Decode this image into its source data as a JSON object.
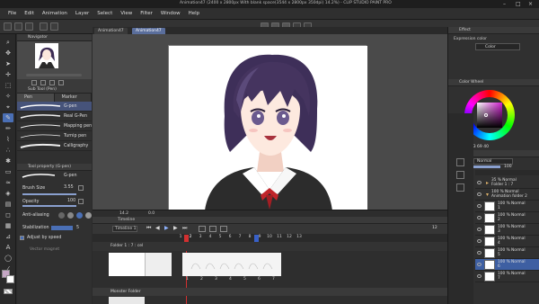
{
  "window": {
    "title": "Animation47 (2400 x 2800px With blank space(3544 x 2800px 350dpi) 14.2%) - CLIP STUDIO PAINT PRO"
  },
  "menu": [
    "File",
    "Edit",
    "Animation",
    "Layer",
    "Select",
    "View",
    "Filter",
    "Window",
    "Help"
  ],
  "canvas_tabs": [
    {
      "label": "Animation47",
      "active": false
    },
    {
      "label": "Animation47",
      "active": true
    }
  ],
  "navigator": {
    "title": "Navigator"
  },
  "subtool": {
    "title": "Sub Tool (Pen)",
    "tabs": [
      "Pen",
      "Marker"
    ],
    "brushes": [
      {
        "name": "G-pen",
        "selected": true
      },
      {
        "name": "Real G-Pen",
        "selected": false
      },
      {
        "name": "Mapping pen",
        "selected": false
      },
      {
        "name": "Turnip pen",
        "selected": false
      },
      {
        "name": "Calligraphy",
        "selected": false
      }
    ]
  },
  "toolprop": {
    "title": "Tool property (G-pen)",
    "preset": "G-pen",
    "brush_size_label": "Brush Size",
    "brush_size_value": "3.55",
    "opacity_label": "Opacity",
    "opacity_value": "100",
    "antialias_label": "Anti-aliasing",
    "stabilization_label": "Stabilization",
    "stabilization_value": "5",
    "adjust_speed_label": "Adjust by speed",
    "vector_magnet_label": "Vector magnet"
  },
  "status": {
    "zoom": "14.2",
    "rotation": "0.0"
  },
  "timeline": {
    "title": "Timeline",
    "name": "Timeline 1",
    "frame_numbers": [
      "1",
      "2",
      "3",
      "4",
      "5",
      "6",
      "7",
      "8",
      "9",
      "10",
      "11",
      "12",
      "13"
    ],
    "cel_numbers": [
      "1",
      "2",
      "3",
      "4",
      "5",
      "6",
      "7"
    ],
    "current_frame": "2",
    "tracks": [
      {
        "label": "Folder 1 : 7 : cel"
      },
      {
        "label": "Monster Folder"
      }
    ],
    "fps": "12"
  },
  "right": {
    "effect_title": "Effect",
    "expression_label": "Expression color",
    "expression_value": "Color",
    "colorwheel_title": "Color Wheel",
    "color_h": "303",
    "color_s": "69",
    "color_v": "40",
    "layer_title": "Layer",
    "blend_mode": "Normal",
    "opacity": "100",
    "layers": [
      {
        "line1": "35 % Normal",
        "line2": "Folder 1 : 7",
        "selected": false,
        "folder": true
      },
      {
        "line1": "100 % Normal",
        "line2": "Animation folder 2",
        "selected": false,
        "folder": true
      },
      {
        "line1": "100 % Normal",
        "line2": "1",
        "selected": false,
        "folder": false
      },
      {
        "line1": "100 % Normal",
        "line2": "2",
        "selected": false,
        "folder": false
      },
      {
        "line1": "100 % Normal",
        "line2": "3",
        "selected": false,
        "folder": false
      },
      {
        "line1": "100 % Normal",
        "line2": "4",
        "selected": false,
        "folder": false
      },
      {
        "line1": "100 % Normal",
        "line2": "5",
        "selected": false,
        "folder": false
      },
      {
        "line1": "100 % Normal",
        "line2": "6",
        "selected": true,
        "folder": false
      },
      {
        "line1": "100 % Normal",
        "line2": "7",
        "selected": false,
        "folder": false
      }
    ]
  },
  "colors": {
    "accent": "#4a6fb5",
    "selection": "#3e5fa2",
    "playhead": "#d23030",
    "fg_color": "#c4a6c4",
    "bg_color": "#ffffff"
  }
}
